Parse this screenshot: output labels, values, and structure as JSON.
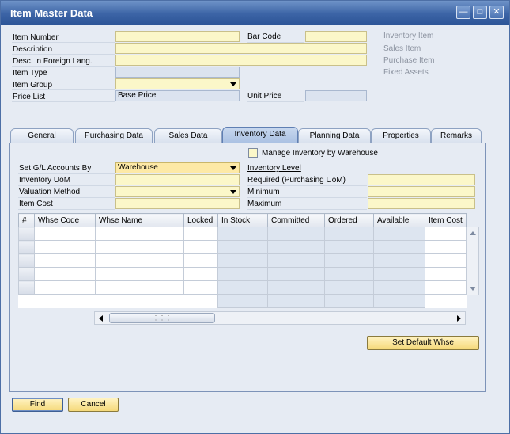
{
  "window": {
    "title": "Item Master Data"
  },
  "header": {
    "item_number": "Item Number",
    "description": "Description",
    "desc_foreign": "Desc. in Foreign Lang.",
    "item_type": "Item Type",
    "item_group": "Item Group",
    "price_list": "Price List",
    "price_list_value": "Base Price",
    "bar_code": "Bar Code",
    "unit_price": "Unit Price",
    "inventory_item": "Inventory Item",
    "sales_item": "Sales Item",
    "purchase_item": "Purchase Item",
    "fixed_assets": "Fixed Assets"
  },
  "tabs": [
    "General",
    "Purchasing Data",
    "Sales Data",
    "Inventory Data",
    "Planning Data",
    "Properties",
    "Remarks"
  ],
  "inventory": {
    "manage_by_warehouse": "Manage Inventory by Warehouse",
    "set_gl_by": "Set G/L Accounts By",
    "set_gl_value": "Warehouse",
    "inventory_uom": "Inventory UoM",
    "valuation_method": "Valuation Method",
    "item_cost": "Item Cost",
    "inventory_level": "Inventory Level",
    "required": "Required (Purchasing UoM)",
    "minimum": "Minimum",
    "maximum": "Maximum"
  },
  "grid": {
    "columns": [
      "#",
      "Whse Code",
      "Whse Name",
      "Locked",
      "In Stock",
      "Committed",
      "Ordered",
      "Available",
      "Item Cost"
    ]
  },
  "buttons": {
    "set_default_whse": "Set Default Whse",
    "find": "Find",
    "cancel": "Cancel"
  },
  "colors": {
    "field_yellow": "#fbf7c9",
    "field_blue": "#dbe3ef",
    "title_blue": "#3c64a6",
    "button_gold": "#f5d97a"
  }
}
